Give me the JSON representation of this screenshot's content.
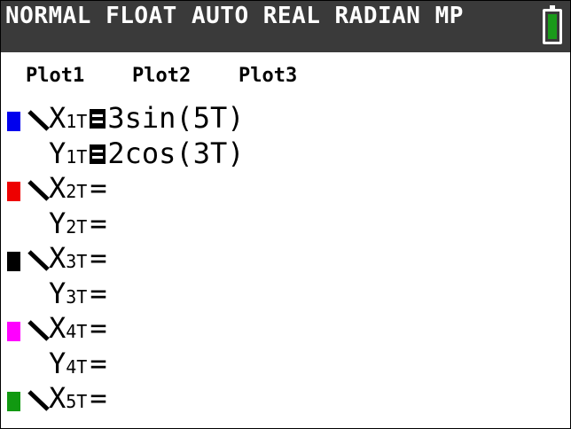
{
  "status_bar": {
    "mode_text": "NORMAL FLOAT AUTO REAL RADIAN MP",
    "battery_color": "#1a9a1a"
  },
  "plots": [
    "Plot1",
    "Plot2",
    "Plot3"
  ],
  "equations": [
    {
      "pair": "1",
      "x_label": "X",
      "y_label": "Y",
      "sub": "1T",
      "color": "#0000ee",
      "x_expr": "3sin(5T)",
      "y_expr": "2cos(3T)",
      "selected": true
    },
    {
      "pair": "2",
      "x_label": "X",
      "y_label": "Y",
      "sub": "2T",
      "color": "#ee0000",
      "x_expr": "",
      "y_expr": "",
      "selected": false
    },
    {
      "pair": "3",
      "x_label": "X",
      "y_label": "Y",
      "sub": "3T",
      "color": "#000000",
      "x_expr": "",
      "y_expr": "",
      "selected": false
    },
    {
      "pair": "4",
      "x_label": "X",
      "y_label": "Y",
      "sub": "4T",
      "color": "#ff00ff",
      "x_expr": "",
      "y_expr": "",
      "selected": false
    },
    {
      "pair": "5",
      "x_label": "X",
      "y_label": "",
      "sub": "5T",
      "color": "#119911",
      "x_expr": "",
      "y_expr": null,
      "selected": false
    }
  ],
  "equals_sign": "="
}
